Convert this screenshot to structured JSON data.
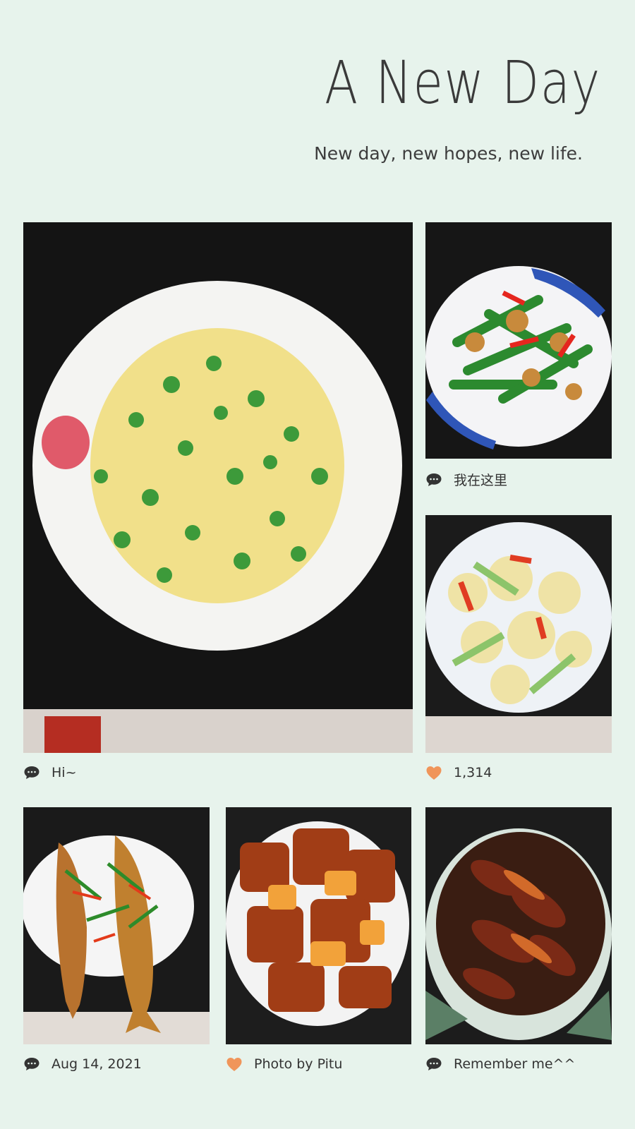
{
  "header": {
    "title": "A New Day",
    "subtitle": "New day, new hopes, new life."
  },
  "colors": {
    "background": "#e7f3ec",
    "chat_icon": "#333333",
    "heart_icon": "#f0955a"
  },
  "tiles": [
    {
      "photo": "scrambled-eggs-with-okra-photo",
      "icon": "chat-bubble-icon",
      "caption": "Hi~"
    },
    {
      "photo": "snap-peas-stir-fry-photo",
      "icon": "chat-bubble-icon",
      "caption": "我在这里"
    },
    {
      "photo": "cauliflower-stir-fry-photo",
      "icon": "heart-icon",
      "caption": "1,314"
    },
    {
      "photo": "braised-fish-photo",
      "icon": "chat-bubble-icon",
      "caption": "Aug 14, 2021"
    },
    {
      "photo": "braised-pork-belly-photo",
      "icon": "heart-icon",
      "caption": "Photo by Pitu"
    },
    {
      "photo": "preserved-vegetable-pork-photo",
      "icon": "chat-bubble-icon",
      "caption": "Remember me^^"
    }
  ]
}
